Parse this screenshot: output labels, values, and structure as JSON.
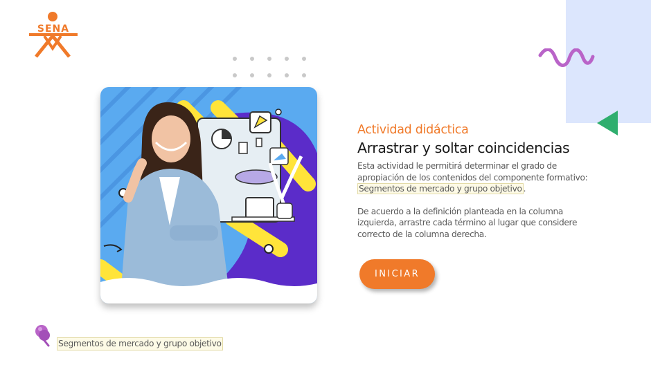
{
  "brand": {
    "logo_text": "SENA",
    "color": "#f07a2a"
  },
  "activity": {
    "kicker": "Actividad didáctica",
    "title": "Arrastrar y soltar coincidencias",
    "intro_text": "Esta actividad le permitirá determinar el grado de apropiación de los contenidos del componente formativo: ",
    "intro_highlight": "Segmentos de mercado y grupo objetivo",
    "intro_end": ".",
    "instructions": "De acuerdo a la definición planteada en la columna izquierda, arrastre cada término al lugar que considere correcto de la columna derecha."
  },
  "start_button": {
    "label": "INICIAR"
  },
  "footer": {
    "topic": "Segmentos de mercado y grupo objetivo",
    "icon": "pin-icon"
  },
  "colors": {
    "accent": "#f07a2a",
    "panel": "#dce6fd",
    "squiggle": "#b964c8",
    "triangle": "#2fae6e",
    "highlight_bg": "#fdfae6"
  }
}
